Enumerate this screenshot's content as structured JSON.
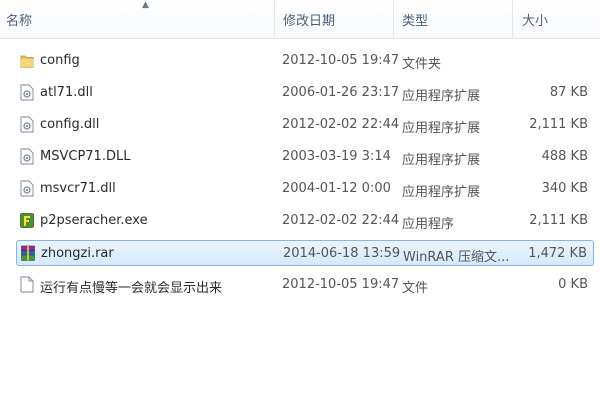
{
  "columns": {
    "name": "名称",
    "date": "修改日期",
    "type": "类型",
    "size": "大小"
  },
  "files": [
    {
      "name": "config",
      "date": "2012-10-05 19:47",
      "type": "文件夹",
      "size": "",
      "icon": "folder-icon"
    },
    {
      "name": "atl71.dll",
      "date": "2006-01-26 23:17",
      "type": "应用程序扩展",
      "size": "87 KB",
      "icon": "dll-file-icon"
    },
    {
      "name": "config.dll",
      "date": "2012-02-02 22:44",
      "type": "应用程序扩展",
      "size": "2,111 KB",
      "icon": "dll-file-icon"
    },
    {
      "name": "MSVCP71.DLL",
      "date": "2003-03-19 3:14",
      "type": "应用程序扩展",
      "size": "488 KB",
      "icon": "dll-file-icon"
    },
    {
      "name": "msvcr71.dll",
      "date": "2004-01-12 0:00",
      "type": "应用程序扩展",
      "size": "340 KB",
      "icon": "dll-file-icon"
    },
    {
      "name": "p2pseracher.exe",
      "date": "2012-02-02 22:44",
      "type": "应用程序",
      "size": "2,111 KB",
      "icon": "exe-app-icon"
    },
    {
      "name": "zhongzi.rar",
      "date": "2014-06-18 13:59",
      "type": "WinRAR 压缩文...",
      "size": "1,472 KB",
      "icon": "winrar-archive-icon",
      "selected": true
    },
    {
      "name": "运行有点慢等一会就会显示出来",
      "date": "2012-10-05 19:47",
      "type": "文件",
      "size": "0 KB",
      "icon": "blank-file-icon"
    }
  ],
  "colors": {
    "selection_fill": "#d6e9fb",
    "selection_border": "#88b5e3",
    "folder": "#e8c15a",
    "exe": "#4f8f2d"
  }
}
